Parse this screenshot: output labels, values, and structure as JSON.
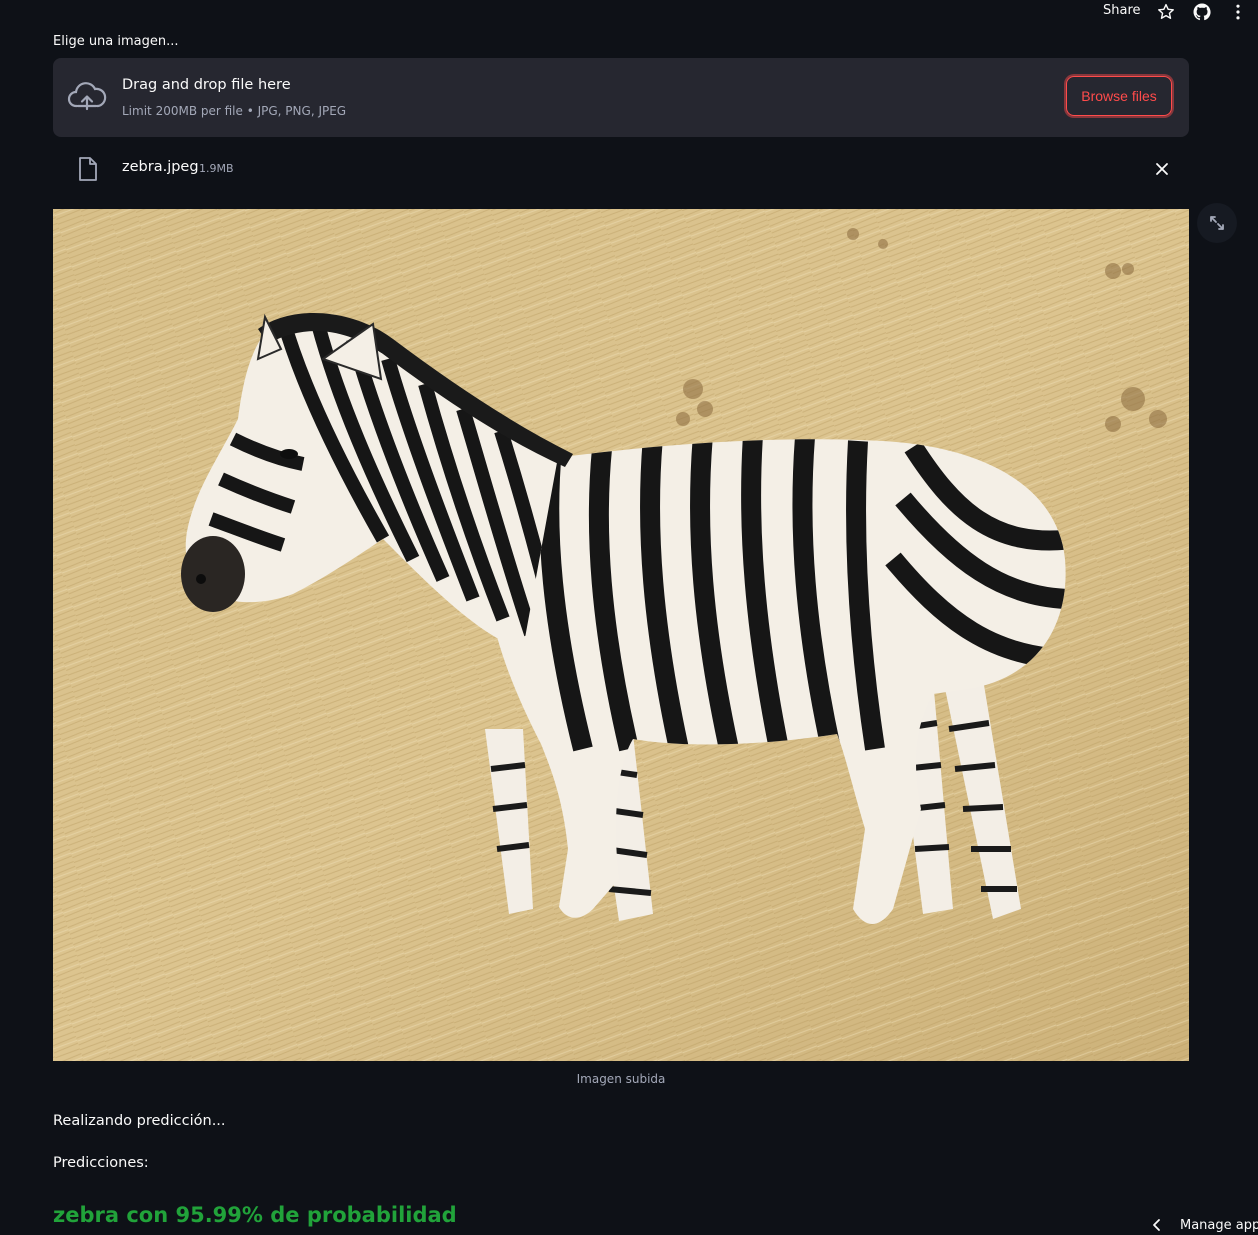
{
  "header": {
    "share_label": "Share",
    "icons": [
      "star-icon",
      "github-icon",
      "more-vertical-icon"
    ]
  },
  "uploader": {
    "label": "Elige una imagen...",
    "drop_title": "Drag and drop file here",
    "drop_subtitle": "Limit 200MB per file • JPG, PNG, JPEG",
    "browse_label": "Browse files",
    "accent_color": "#ff4b4b"
  },
  "file": {
    "name": "zebra.jpeg",
    "size": "1.9MB"
  },
  "image": {
    "caption": "Imagen subida",
    "subject": "zebra standing in dry golden grass"
  },
  "status": {
    "progress_text": "Realizando predicción...",
    "heading": "Predicciones:",
    "result": "zebra con 95.99% de probabilidad",
    "result_color": "#21a33a"
  },
  "footer": {
    "manage_label": "Manage app"
  },
  "theme": {
    "background": "#0e1117",
    "panel": "#262730"
  }
}
